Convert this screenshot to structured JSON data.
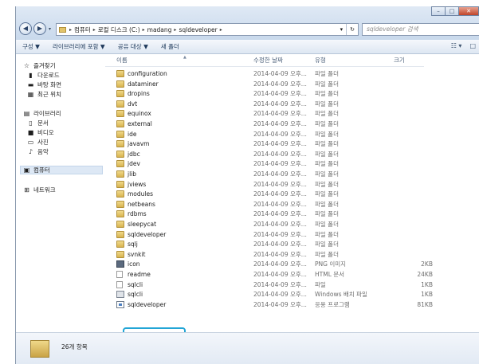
{
  "window": {
    "controls": [
      "–",
      "□",
      "✕"
    ]
  },
  "nav": {
    "back": "◀",
    "forward": "▶",
    "dropdown": "▾"
  },
  "address": {
    "crumbs": [
      "컴퓨터",
      "로컬 디스크 (C:)",
      "madang",
      "sqldeveloper"
    ],
    "separator": "▸",
    "dropdown": "▾",
    "refresh": "↻"
  },
  "search": {
    "placeholder": "sqldeveloper 검색"
  },
  "toolbar": {
    "items": [
      "구성 ▼",
      "라이브러리에 포함 ▼",
      "공유 대상 ▼",
      "새 폴더"
    ],
    "views": "☷ ▾",
    "preview": "□"
  },
  "navpane": {
    "favorites": "즐겨찾기",
    "downloads": "다운로드",
    "desktop": "바탕 화면",
    "recent": "최근 위치",
    "libraries": "라이브러리",
    "documents": "문서",
    "videos": "비디오",
    "pictures": "사진",
    "music": "음악",
    "computer": "컴퓨터",
    "network": "네트워크"
  },
  "columns": {
    "name": "이름",
    "date": "수정한 날짜",
    "type": "유형",
    "size": "크기"
  },
  "files": [
    {
      "name": "configuration",
      "date": "2014-04-09 오후...",
      "type": "파일 폴더",
      "size": "",
      "icon": "folder"
    },
    {
      "name": "dataminer",
      "date": "2014-04-09 오후...",
      "type": "파일 폴더",
      "size": "",
      "icon": "folder"
    },
    {
      "name": "dropins",
      "date": "2014-04-09 오후...",
      "type": "파일 폴더",
      "size": "",
      "icon": "folder"
    },
    {
      "name": "dvt",
      "date": "2014-04-09 오후...",
      "type": "파일 폴더",
      "size": "",
      "icon": "folder"
    },
    {
      "name": "equinox",
      "date": "2014-04-09 오후...",
      "type": "파일 폴더",
      "size": "",
      "icon": "folder"
    },
    {
      "name": "external",
      "date": "2014-04-09 오후...",
      "type": "파일 폴더",
      "size": "",
      "icon": "folder"
    },
    {
      "name": "ide",
      "date": "2014-04-09 오후...",
      "type": "파일 폴더",
      "size": "",
      "icon": "folder"
    },
    {
      "name": "javavm",
      "date": "2014-04-09 오후...",
      "type": "파일 폴더",
      "size": "",
      "icon": "folder"
    },
    {
      "name": "jdbc",
      "date": "2014-04-09 오후...",
      "type": "파일 폴더",
      "size": "",
      "icon": "folder"
    },
    {
      "name": "jdev",
      "date": "2014-04-09 오후...",
      "type": "파일 폴더",
      "size": "",
      "icon": "folder"
    },
    {
      "name": "jlib",
      "date": "2014-04-09 오후...",
      "type": "파일 폴더",
      "size": "",
      "icon": "folder"
    },
    {
      "name": "jviews",
      "date": "2014-04-09 오후...",
      "type": "파일 폴더",
      "size": "",
      "icon": "folder"
    },
    {
      "name": "modules",
      "date": "2014-04-09 오후...",
      "type": "파일 폴더",
      "size": "",
      "icon": "folder"
    },
    {
      "name": "netbeans",
      "date": "2014-04-09 오후...",
      "type": "파일 폴더",
      "size": "",
      "icon": "folder"
    },
    {
      "name": "rdbms",
      "date": "2014-04-09 오후...",
      "type": "파일 폴더",
      "size": "",
      "icon": "folder"
    },
    {
      "name": "sleepycat",
      "date": "2014-04-09 오후...",
      "type": "파일 폴더",
      "size": "",
      "icon": "folder"
    },
    {
      "name": "sqldeveloper",
      "date": "2014-04-09 오후...",
      "type": "파일 폴더",
      "size": "",
      "icon": "folder"
    },
    {
      "name": "sqlj",
      "date": "2014-04-09 오후...",
      "type": "파일 폴더",
      "size": "",
      "icon": "folder"
    },
    {
      "name": "svnkit",
      "date": "2014-04-09 오후...",
      "type": "파일 폴더",
      "size": "",
      "icon": "folder"
    },
    {
      "name": "icon",
      "date": "2014-04-09 오후...",
      "type": "PNG 이미지",
      "size": "2KB",
      "icon": "ico"
    },
    {
      "name": "readme",
      "date": "2014-04-09 오후...",
      "type": "HTML 문서",
      "size": "24KB",
      "icon": "html"
    },
    {
      "name": "sqlcli",
      "date": "2014-04-09 오후...",
      "type": "파일",
      "size": "1KB",
      "icon": "file"
    },
    {
      "name": "sqlcli",
      "date": "2014-04-09 오후...",
      "type": "Windows 배치 파일",
      "size": "1KB",
      "icon": "bat"
    },
    {
      "name": "sqldeveloper",
      "date": "2014-04-09 오후...",
      "type": "응용 프로그램",
      "size": "81KB",
      "icon": "exe"
    }
  ],
  "status": {
    "count": "26개 항목"
  }
}
